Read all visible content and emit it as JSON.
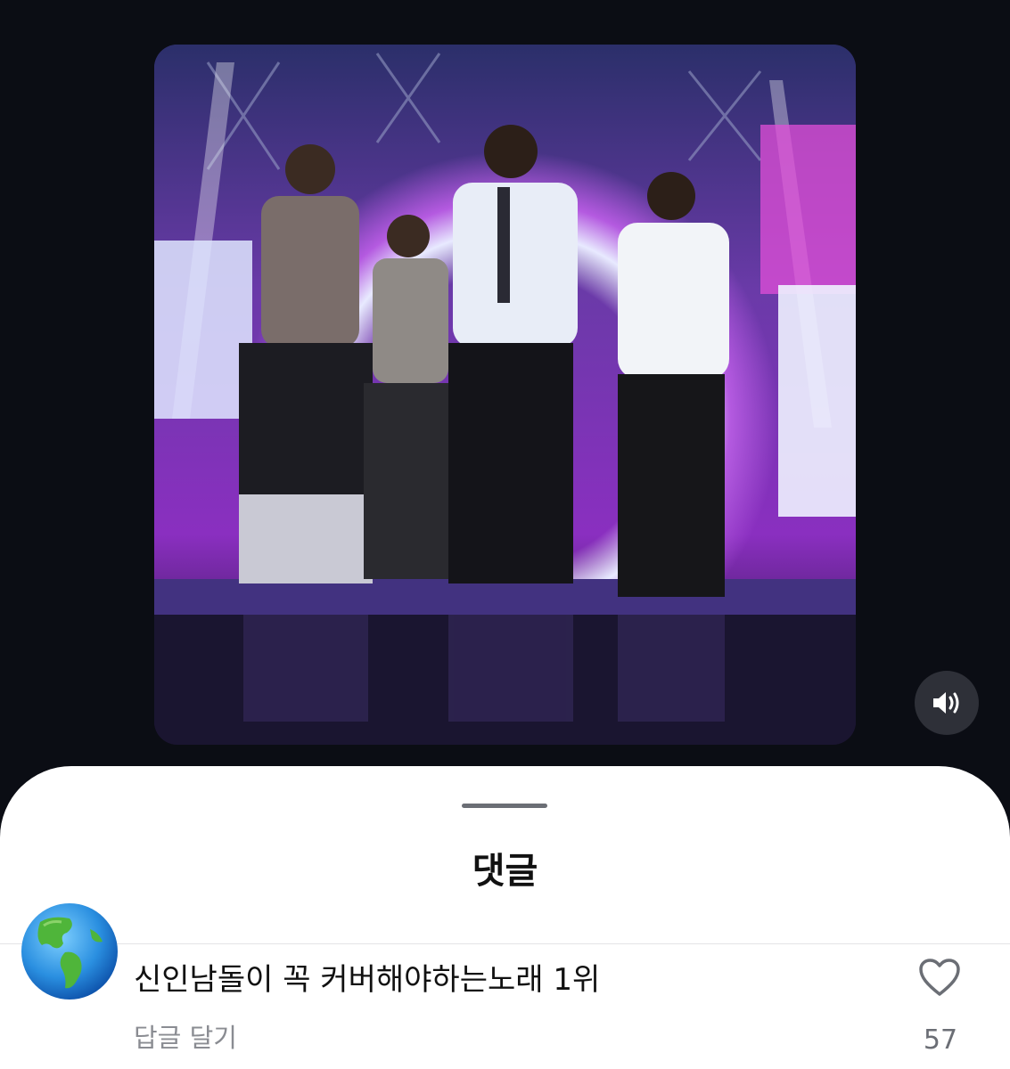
{
  "video": {
    "mute_icon": "speaker-volume-icon"
  },
  "comments_sheet": {
    "title": "댓글",
    "comment": {
      "avatar_icon": "globe-americas-emoji",
      "text": "신인남돌이 꼭 커버해야하는노래 1위",
      "reply_label": "답글 달기",
      "like_icon": "heart-outline-icon",
      "like_count": "57"
    }
  },
  "colors": {
    "background": "#0b0d14",
    "sheet": "#ffffff",
    "secondary_text": "#8a8c92"
  }
}
